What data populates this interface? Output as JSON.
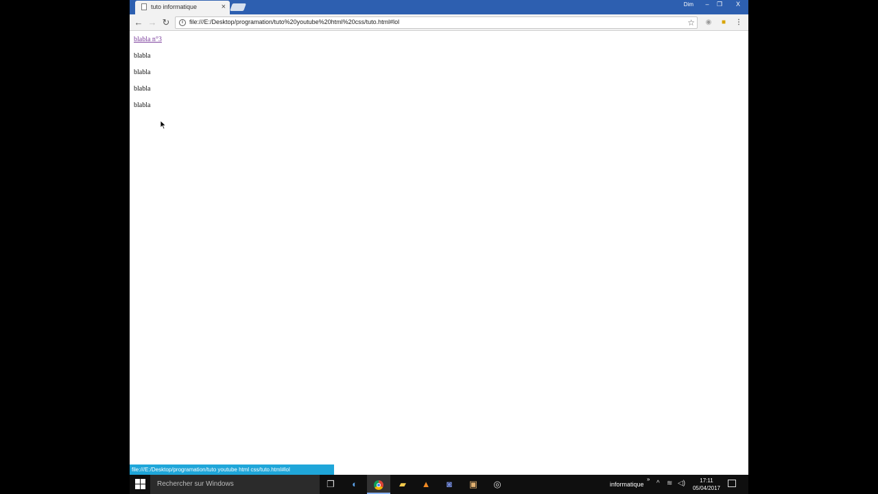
{
  "browser": {
    "tab_title": "tuto informatique",
    "tab_close": "×",
    "profile_name": "Dim",
    "window_buttons": {
      "minimize": "–",
      "maximize": "❐",
      "close": "X"
    },
    "url": "file:///E:/Desktop/programation/tuto%20youtube%20html%20css/tuto.html#lol",
    "icons": {
      "back": "back-arrow-icon",
      "forward": "forward-arrow-icon",
      "reload": "reload-icon",
      "info": "info-icon",
      "star": "star-icon",
      "menu": "kebab-menu-icon"
    }
  },
  "page": {
    "link_text": "blabla n°3",
    "paragraphs": [
      "blabla",
      "blabla",
      "blabla",
      "blabla"
    ]
  },
  "statusbar": {
    "text": "file:///E:/Desktop/programation/tuto youtube html css/tuto.html#lol"
  },
  "taskbar": {
    "search_placeholder": "Rechercher sur Windows",
    "tray_label": "informatique",
    "tray_more": "»",
    "time": "17:11",
    "date": "05/04/2017"
  }
}
